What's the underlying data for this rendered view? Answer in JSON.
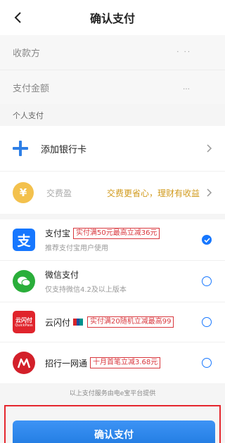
{
  "header": {
    "title": "确认支付"
  },
  "info": {
    "payee_label": "收款方",
    "payee_value": "· ··",
    "amount_label": "支付金额",
    "amount_value": "…"
  },
  "section": {
    "personal_label": "个人支付"
  },
  "add_card": {
    "label": "添加银行卡"
  },
  "fee": {
    "label": "交费盈",
    "promo": "交费更省心，理财有收益"
  },
  "methods": [
    {
      "name": "支付宝",
      "tag": "实付满50元最高立减36元",
      "sub": "推荐支付宝用户使用",
      "checked": true
    },
    {
      "name": "微信支付",
      "tag": "",
      "sub": "仅支持微信4.2及以上版本",
      "checked": false
    },
    {
      "name": "云闪付",
      "tag": "实付满20随机立减最高99",
      "sub": "",
      "checked": false
    },
    {
      "name": "招行一网通",
      "tag": "十月首笔立减3.68元",
      "sub": "",
      "checked": false
    }
  ],
  "icons": {
    "back": "chevron-left-icon",
    "add": "plus-icon",
    "fee": "yen-coin-icon",
    "alipay": "alipay-icon",
    "wechat": "wechat-icon",
    "unionpay": "unionpay-icon",
    "cmb": "cmb-icon"
  },
  "unionpay_icon_text": {
    "line1": "云闪付",
    "line2": "QuickPass"
  },
  "footer_note": "以上支付服务由电e宝平台提供",
  "confirm_button": "确认支付",
  "colors": {
    "accent": "#1677ff",
    "promo_gold": "#d19a1c",
    "tag_red": "#d8363c",
    "highlight": "#e5262d"
  }
}
